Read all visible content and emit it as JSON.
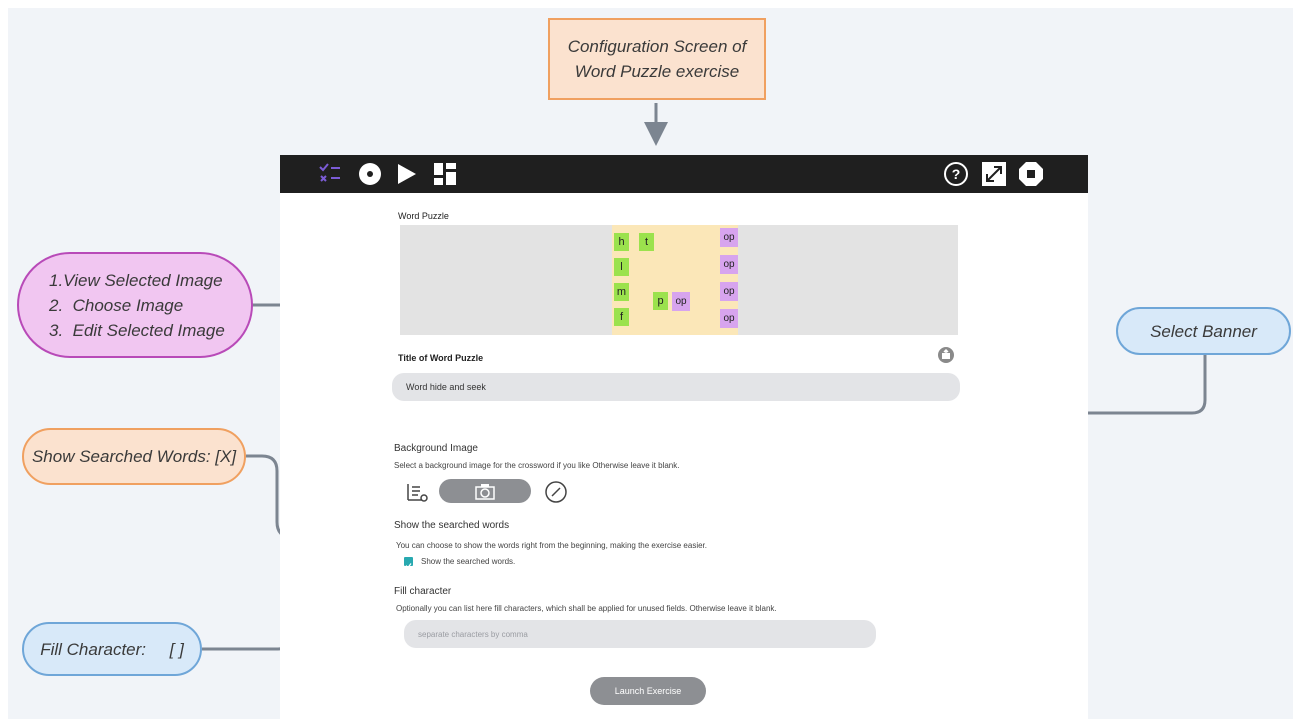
{
  "callouts": {
    "config_title": [
      "Configuration Screen of",
      "Word Puzzle exercise"
    ],
    "image_actions": [
      "1.View Selected Image",
      "2.  Choose Image",
      "3.  Edit Selected Image"
    ],
    "show_words": "Show Searched Words: [X]",
    "fill_char": "Fill Character:     [ ]",
    "select_banner": "Select Banner"
  },
  "toolbar": {
    "left_icons": [
      "checklist-icon",
      "disc-icon",
      "play-icon",
      "grid-icon"
    ],
    "right_icons": [
      "help-icon",
      "fullscreen-icon",
      "stop-icon"
    ]
  },
  "app": {
    "puzzle_label": "Word Puzzle",
    "puzzle_cells": [
      "h",
      "t",
      "l",
      "m",
      "f",
      "p",
      "op",
      "op",
      "op",
      "op",
      "op"
    ],
    "title_label": "Title of Word Puzzle",
    "title_value": "Word hide and seek",
    "background": {
      "heading": "Background Image",
      "description": "Select a background image for the crossword if you like Otherwise leave it blank."
    },
    "show_words": {
      "heading": "Show the searched words",
      "description": "You can choose to show the words right from the beginning, making the exercise easier.",
      "checkbox_label": "Show the searched words.",
      "checked": true
    },
    "fill": {
      "heading": "Fill character",
      "description": "Optionally you can list here fill characters, which shall be applied for unused fields. Otherwise leave it blank.",
      "placeholder": "separate characters by comma"
    },
    "launch_label": "Launch Exercise"
  },
  "colors": {
    "toolbar": "#1f1f1f",
    "callout_orange": "#fbe2cf",
    "callout_pink": "#f1c6f1",
    "callout_blue": "#d8e9f9",
    "arrow": "#7c8591",
    "cell_green": "#9be24d",
    "cell_purple": "#d7a4ee",
    "grid_bg": "#fbe7b8",
    "checkbox": "#28a9b0"
  }
}
